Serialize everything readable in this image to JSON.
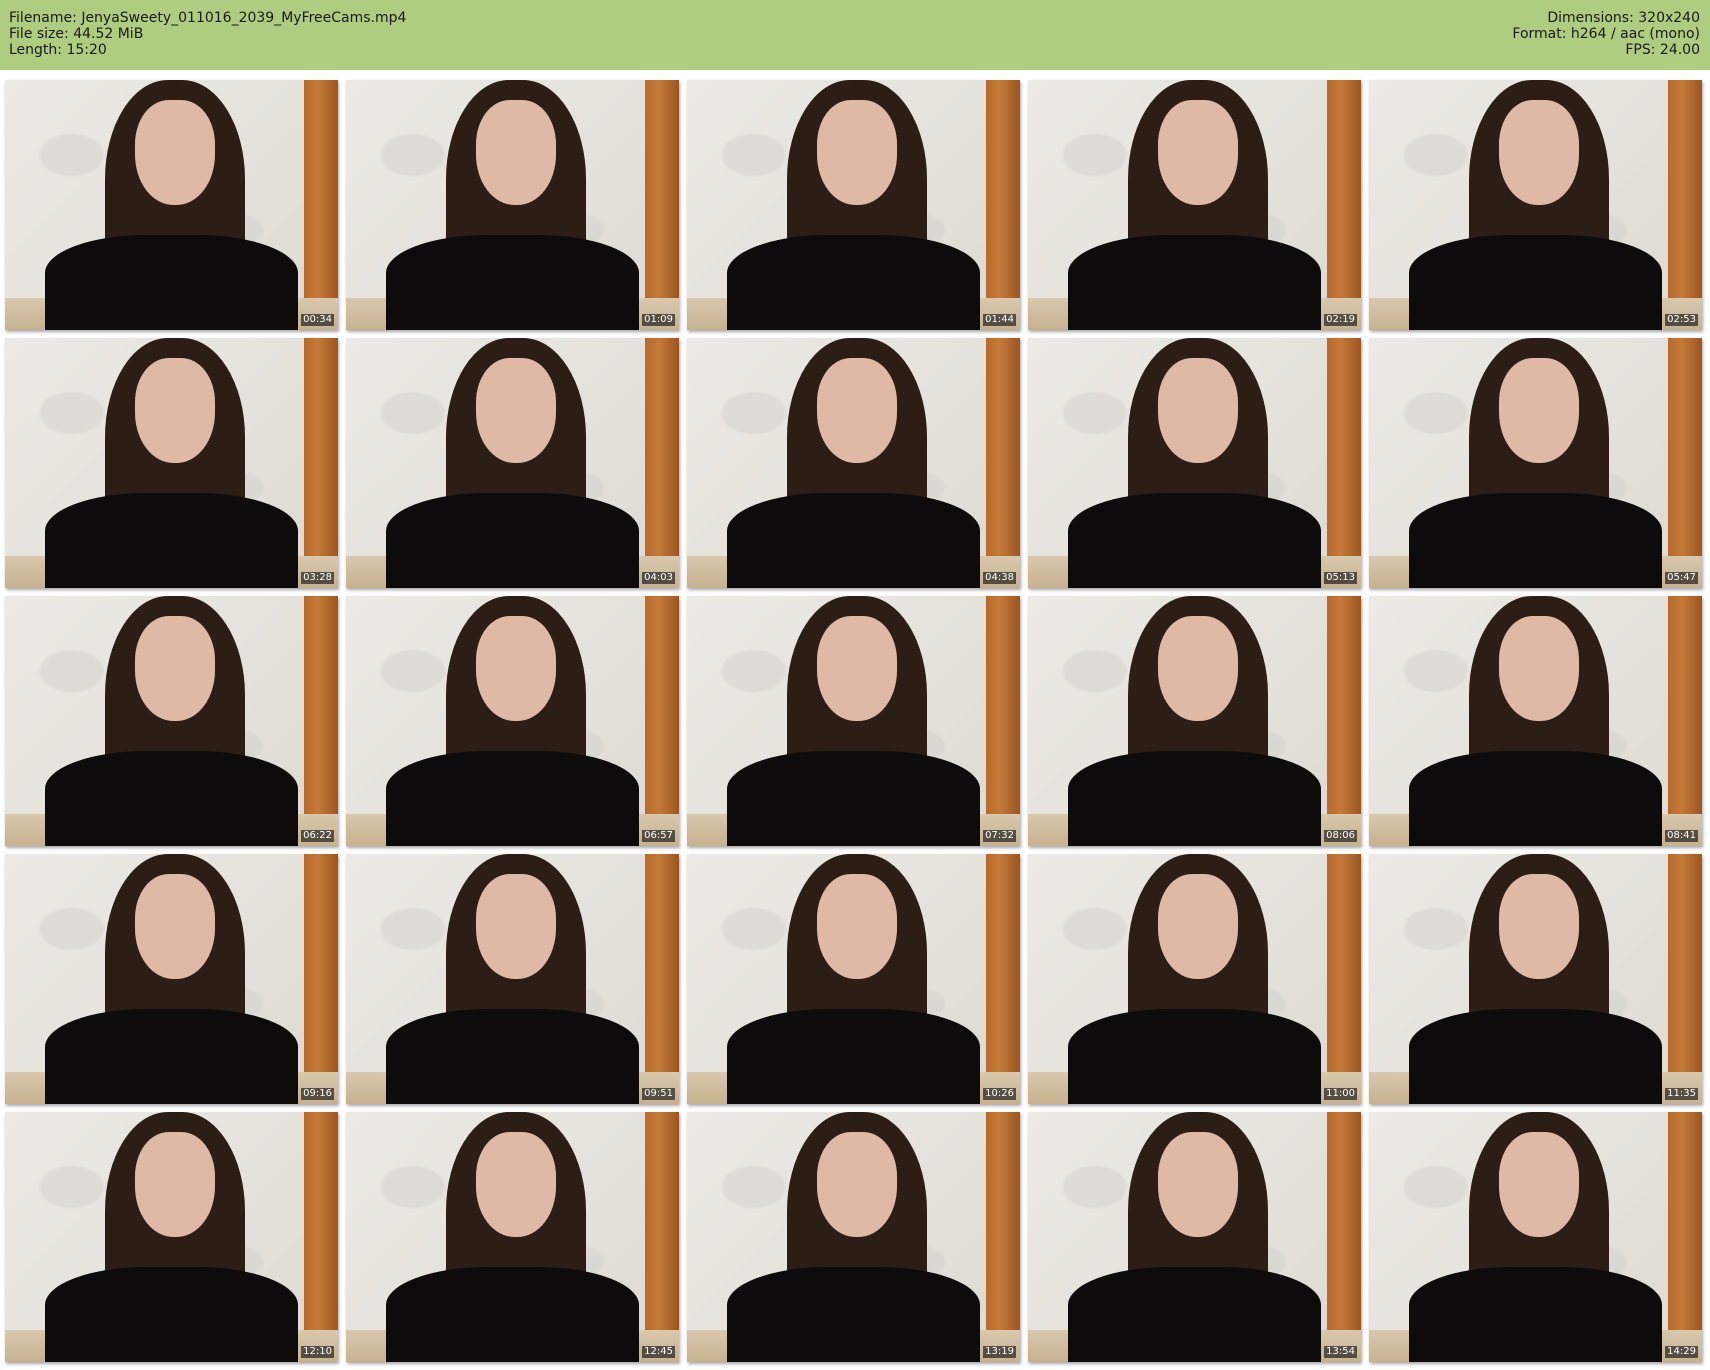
{
  "header": {
    "filename_label": "Filename:",
    "filename": "JenyaSweety_011016_2039_MyFreeCams.mp4",
    "filesize_label": "File size:",
    "filesize": "44.52 MiB",
    "length_label": "Length:",
    "length": "15:20",
    "dimensions_label": "Dimensions:",
    "dimensions": "320x240",
    "format_label": "Format:",
    "format": "h264 / aac (mono)",
    "fps_label": "FPS:",
    "fps": "24.00"
  },
  "thumbnails": [
    "00:34",
    "01:09",
    "01:44",
    "02:19",
    "02:53",
    "03:28",
    "04:03",
    "04:38",
    "05:13",
    "05:47",
    "06:22",
    "06:57",
    "07:32",
    "08:06",
    "08:41",
    "09:16",
    "09:51",
    "10:26",
    "11:00",
    "11:35",
    "12:10",
    "12:45",
    "13:19",
    "13:54",
    "14:29"
  ],
  "colors": {
    "header_bg": "#afcd80",
    "page_bg": "#ffffff"
  }
}
